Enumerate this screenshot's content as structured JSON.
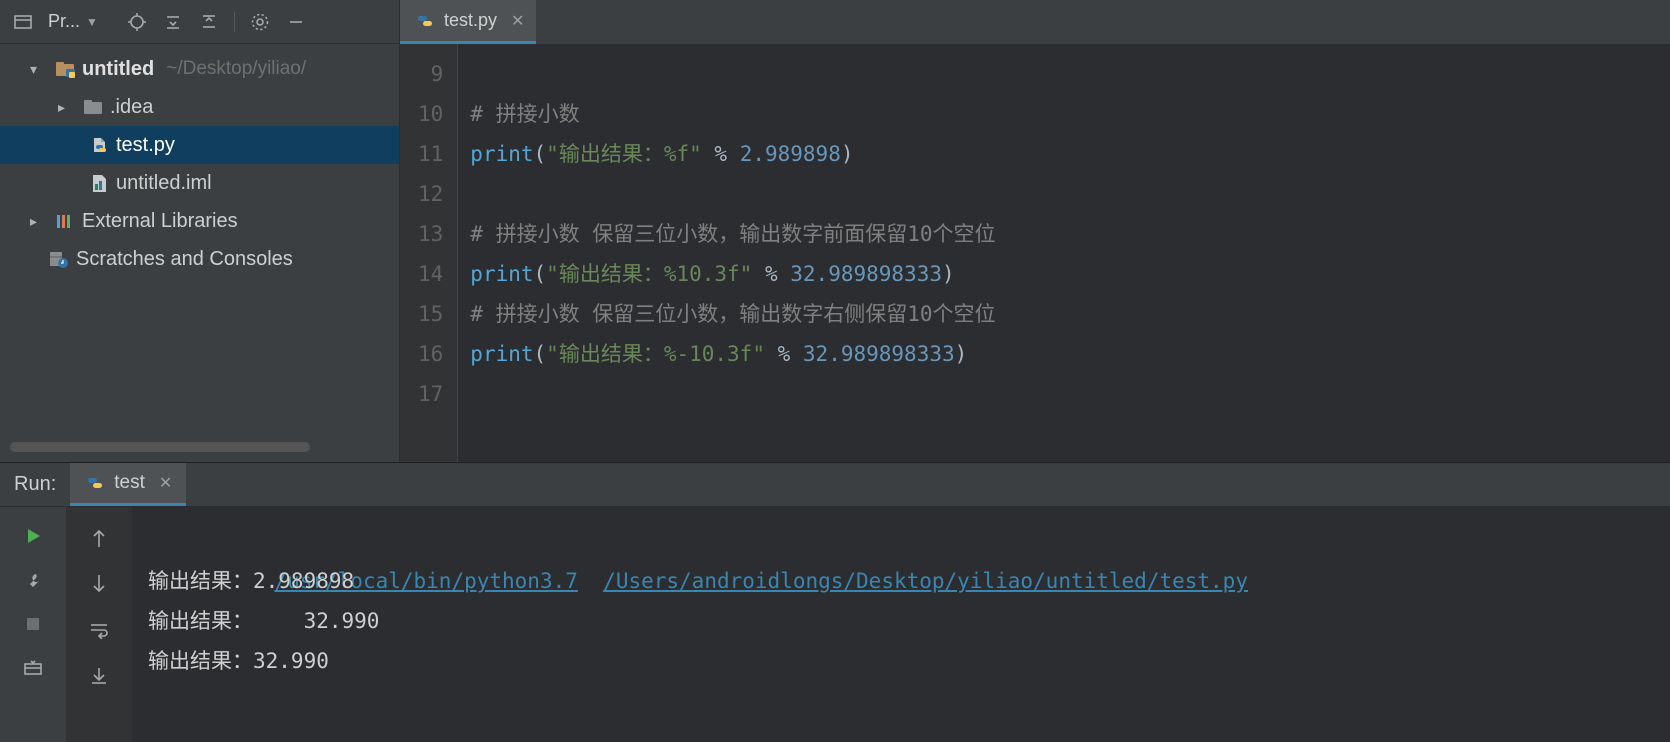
{
  "sidebar": {
    "title_short": "Pr...",
    "root_name": "untitled",
    "root_path": "~/Desktop/yiliao/",
    "items": [
      {
        "name": ".idea",
        "type": "folder"
      },
      {
        "name": "test.py",
        "type": "python"
      },
      {
        "name": "untitled.iml",
        "type": "iml"
      }
    ],
    "external_label": "External Libraries",
    "scratches_label": "Scratches and Consoles"
  },
  "tab": {
    "label": "test.py"
  },
  "editor": {
    "lines": [
      {
        "n": 9,
        "t": "blank"
      },
      {
        "n": 10,
        "t": "cmt",
        "text": "# 拼接小数"
      },
      {
        "n": 11,
        "t": "print",
        "str": "\"输出结果：%f\"",
        "num": "2.989898"
      },
      {
        "n": 12,
        "t": "blank"
      },
      {
        "n": 13,
        "t": "cmt",
        "text": "# 拼接小数 保留三位小数，输出数字前面保留10个空位"
      },
      {
        "n": 14,
        "t": "print",
        "str": "\"输出结果：%10.3f\"",
        "num": "32.989898333"
      },
      {
        "n": 15,
        "t": "cmt",
        "text": "# 拼接小数 保留三位小数，输出数字右侧保留10个空位"
      },
      {
        "n": 16,
        "t": "print",
        "str": "\"输出结果：%-10.3f\"",
        "num": "32.989898333"
      },
      {
        "n": 17,
        "t": "blank"
      }
    ]
  },
  "run": {
    "label": "Run:",
    "tab_label": "test",
    "link1": "/usr/local/bin/python3.7",
    "link2": "/Users/androidlongs/Desktop/yiliao/untitled/test.py",
    "out": [
      "输出结果：2.989898",
      "输出结果：    32.990",
      "输出结果：32.990"
    ]
  }
}
